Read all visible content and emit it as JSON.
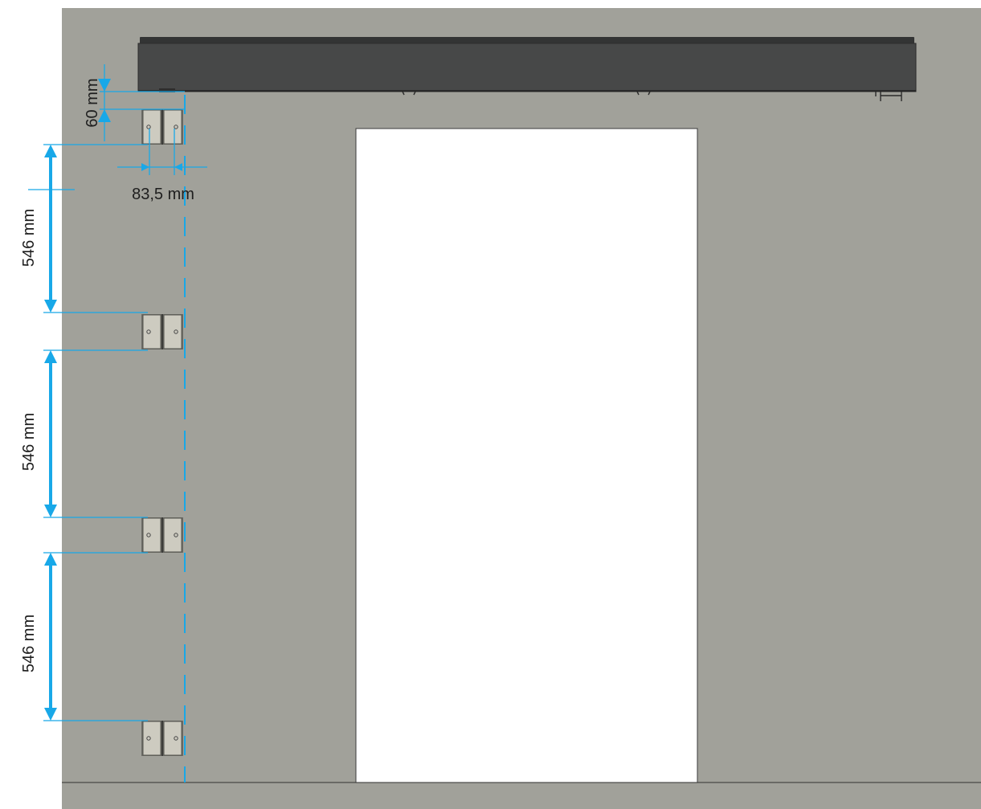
{
  "dimensions": {
    "top_offset": "60 mm",
    "bracket_width": "83,5 mm",
    "spacing_1": "546 mm",
    "spacing_2": "546 mm",
    "spacing_3": "546 mm"
  },
  "colors": {
    "wall": "#a1a19a",
    "rail": "#474848",
    "rail_top": "#333434",
    "opening": "#ffffff",
    "dimension": "#18a8e8",
    "bracket_plate": "#cdcbc0",
    "bracket_edge": "#55554f",
    "text": "#1e1e1e"
  },
  "brackets": [
    {
      "id": "bracket-1"
    },
    {
      "id": "bracket-2"
    },
    {
      "id": "bracket-3"
    },
    {
      "id": "bracket-4"
    }
  ]
}
